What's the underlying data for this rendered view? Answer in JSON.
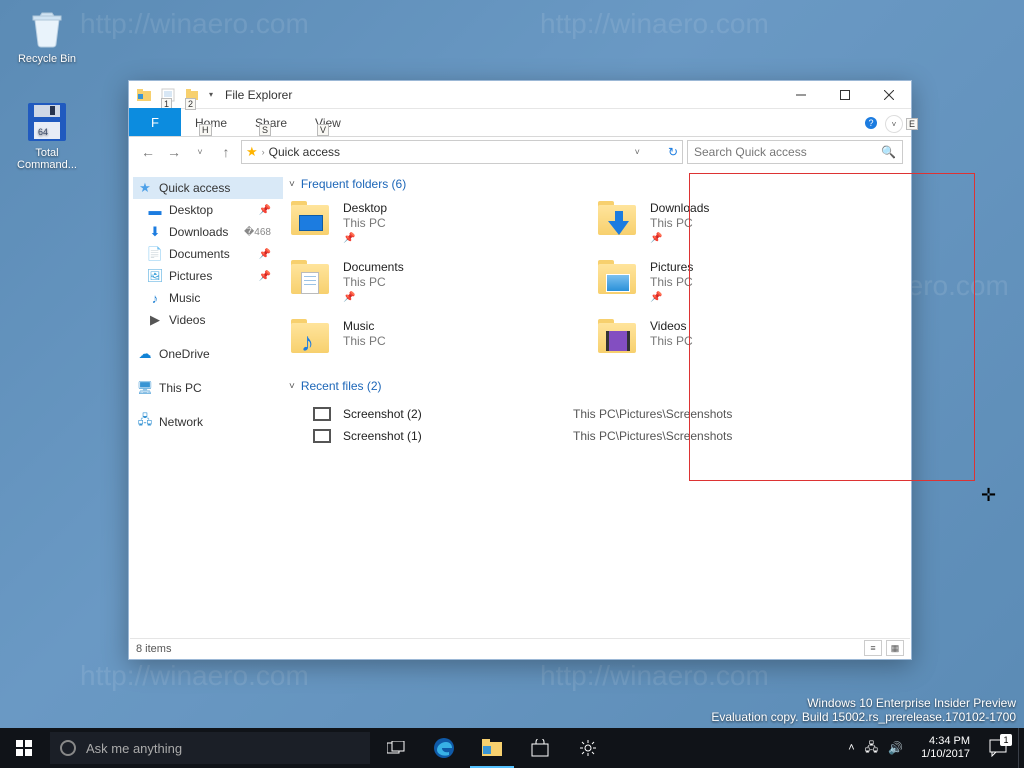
{
  "desktop": {
    "recycle": "Recycle Bin",
    "tc": "Total Command..."
  },
  "window": {
    "title": "File Explorer",
    "qat": {
      "k1": "1",
      "k2": "2"
    },
    "ribbon": {
      "file": "F",
      "tabs": [
        {
          "label": "Home",
          "key": "H"
        },
        {
          "label": "Share",
          "key": "S"
        },
        {
          "label": "View",
          "key": "V"
        }
      ]
    },
    "nav": {
      "breadcrumb": "Quick access"
    },
    "search": {
      "placeholder": "Search Quick access"
    },
    "status": "8 items"
  },
  "sidebar": {
    "quick": "Quick access",
    "items": [
      {
        "label": "Desktop",
        "pin": true
      },
      {
        "label": "Downloads",
        "pin": true
      },
      {
        "label": "Documents",
        "pin": true
      },
      {
        "label": "Pictures",
        "pin": true
      },
      {
        "label": "Music",
        "pin": false
      },
      {
        "label": "Videos",
        "pin": false
      }
    ],
    "onedrive": "OneDrive",
    "thispc": "This PC",
    "network": "Network"
  },
  "content": {
    "groups": {
      "freq": "Frequent folders (6)",
      "recent": "Recent files (2)"
    },
    "folders": [
      {
        "name": "Desktop",
        "sub": "This PC",
        "pin": true,
        "special": "desktop"
      },
      {
        "name": "Downloads",
        "sub": "This PC",
        "pin": true,
        "special": "downloads"
      },
      {
        "name": "Documents",
        "sub": "This PC",
        "pin": true,
        "special": "documents"
      },
      {
        "name": "Pictures",
        "sub": "This PC",
        "pin": true,
        "special": "pictures"
      },
      {
        "name": "Music",
        "sub": "This PC",
        "pin": false,
        "special": "music"
      },
      {
        "name": "Videos",
        "sub": "This PC",
        "pin": false,
        "special": "videos"
      }
    ],
    "recent": [
      {
        "name": "Screenshot (2)",
        "path": "This PC\\Pictures\\Screenshots"
      },
      {
        "name": "Screenshot (1)",
        "path": "This PC\\Pictures\\Screenshots"
      }
    ]
  },
  "winedition": {
    "line1": "Windows 10 Enterprise Insider Preview",
    "line2": "Evaluation copy. Build 15002.rs_prerelease.170102-1700"
  },
  "taskbar": {
    "search": "Ask me anything",
    "time": "4:34 PM",
    "date": "1/10/2017",
    "notif": "1"
  },
  "ribcol_key": "E"
}
